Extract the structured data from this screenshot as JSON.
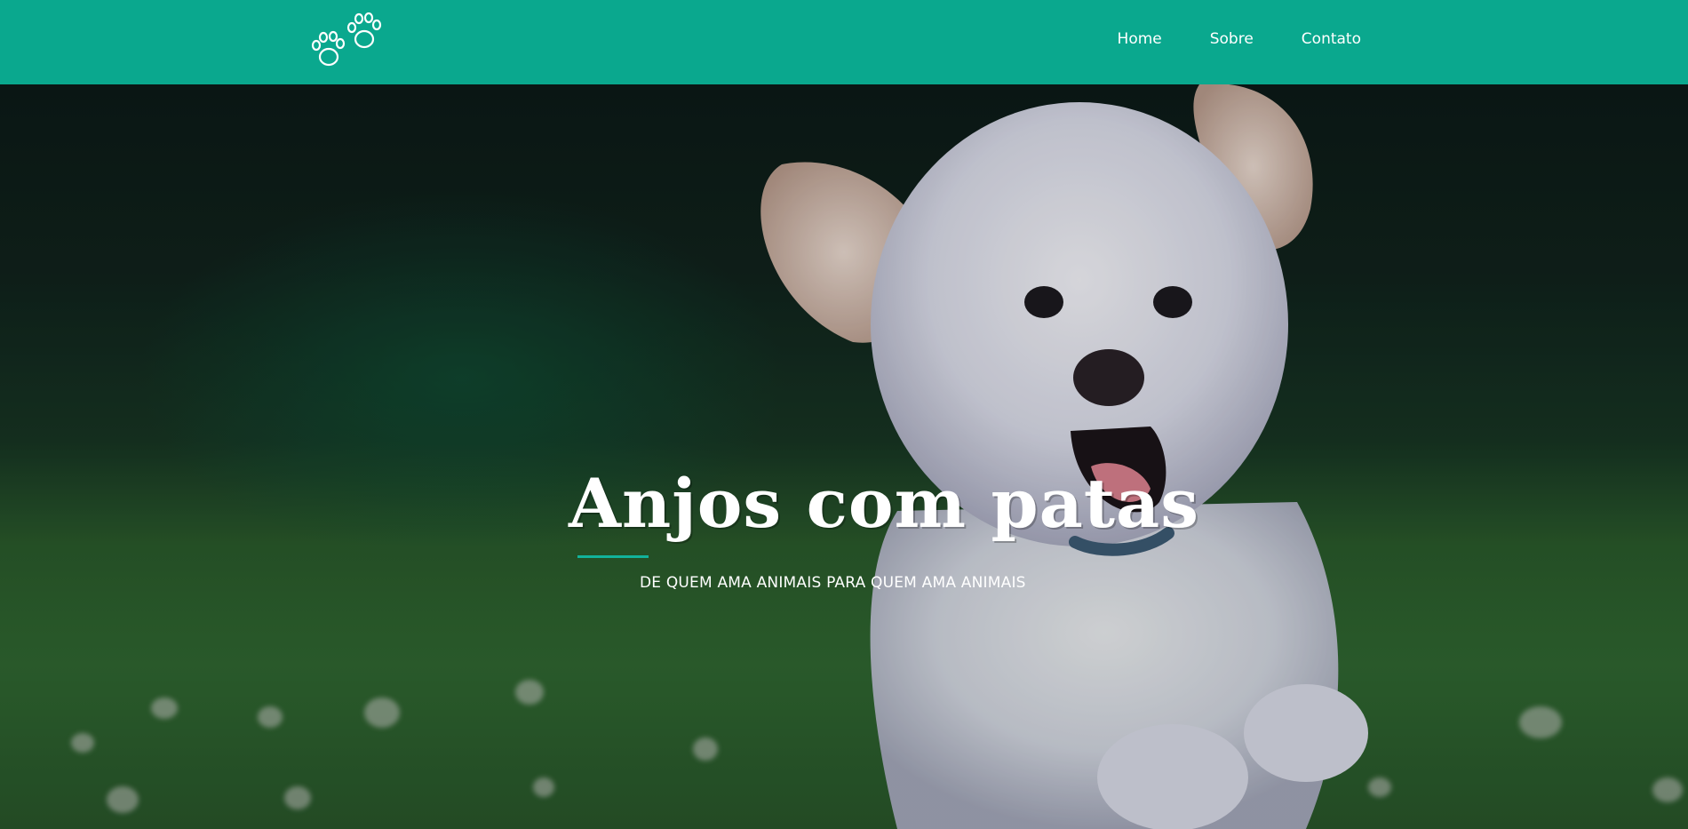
{
  "brand": {
    "logo_icon": "paw-prints-icon",
    "accent_color": "#0aa88e"
  },
  "nav": {
    "items": [
      {
        "label": "Home"
      },
      {
        "label": "Sobre"
      },
      {
        "label": "Contato"
      }
    ]
  },
  "hero": {
    "title": "Anjos com patas",
    "subtitle": "DE QUEM AMA ANIMAIS PARA QUEM AMA ANIMAIS",
    "underline_color": "#12b39b",
    "background_image": "running-dog-photo"
  }
}
